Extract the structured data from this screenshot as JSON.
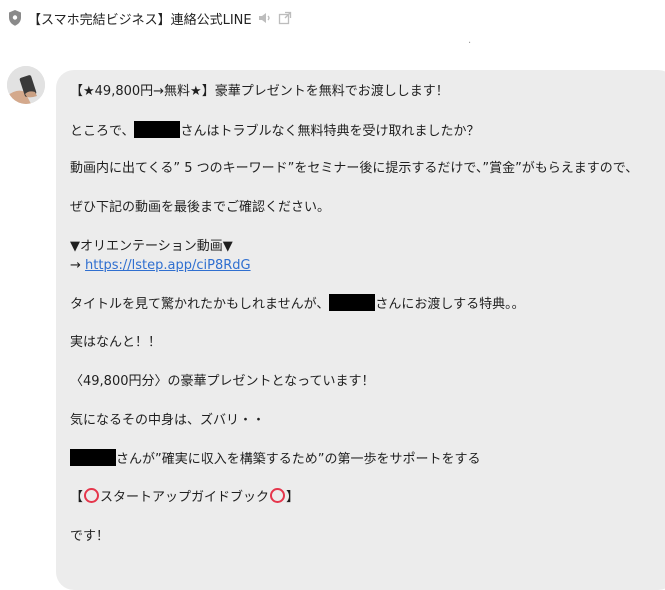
{
  "header": {
    "title": "【スマホ完結ビジネス】連絡公式LINE"
  },
  "typing_dot": "·",
  "message": {
    "line1": "【★49,800円→無料★】豪華プレゼントを無料でお渡しします！",
    "line2_pre": "ところで、",
    "line2_post": "さんはトラブルなく無料特典を受け取れましたか？",
    "line3": "動画内に出てくる” 5 つのキーワード”をセミナー後に提示するだけで、”賞金”がもらえますので、",
    "line4": "ぜひ下記の動画を最後までご確認ください。",
    "line5": "▼オリエンテーション動画▼",
    "line6_arrow": "→ ",
    "link_text": "https://lstep.app/ciP8RdG",
    "line7_pre": "タイトルを見て驚かれたかもしれませんが、",
    "line7_post": "さんにお渡しする特典。。",
    "line8": "実はなんと！！",
    "line9": "〈49,800円分〉の豪華プレゼントとなっています！",
    "line10": "気になるその中身は、ズバリ・・",
    "line11_post": "さんが”確実に収入を構築するため”の第一歩をサポートをする",
    "line12_open": "【",
    "line12_mid": "スタートアップガイドブック",
    "line12_close": "】",
    "line13": "です！"
  }
}
